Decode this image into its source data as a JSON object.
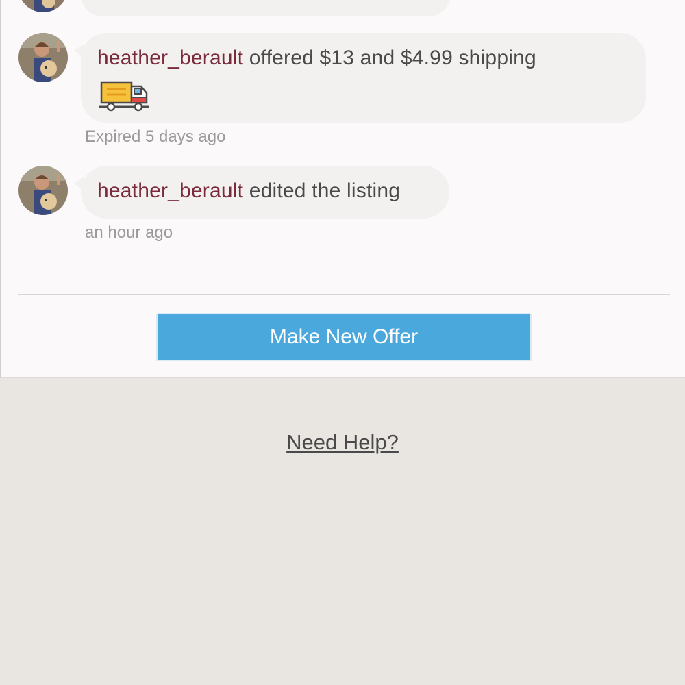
{
  "messages": [
    {
      "username": "heather_berault",
      "text": " offered $13 and $4.99 shipping",
      "icon": "shipping-truck-icon",
      "time": "Expired 5 days ago"
    },
    {
      "username": "heather_berault",
      "text": " edited the listing",
      "time": "an hour ago"
    }
  ],
  "actions": {
    "make_offer_label": "Make New Offer"
  },
  "footer": {
    "help_label": "Need Help?"
  },
  "colors": {
    "accent": "#4aa8dc",
    "username": "#7a2a3a",
    "bubble": "#f3f1ef",
    "footer_bg": "#e9e6e2"
  }
}
